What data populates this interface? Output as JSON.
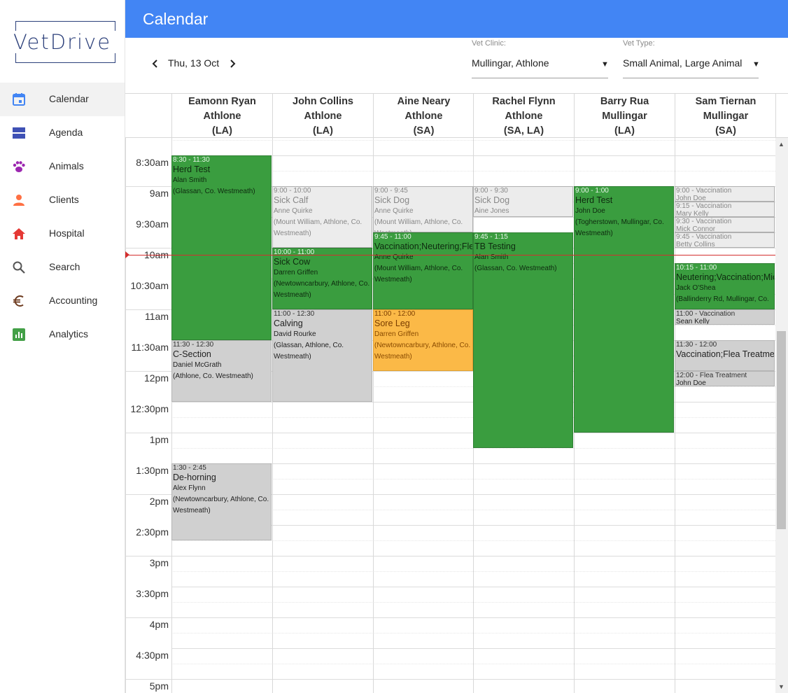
{
  "app": {
    "brand": "VetDrive"
  },
  "header": {
    "title": "Calendar"
  },
  "nav": [
    {
      "label": "Calendar",
      "icon": "calendar-icon",
      "active": true
    },
    {
      "label": "Agenda",
      "icon": "agenda-icon",
      "active": false
    },
    {
      "label": "Animals",
      "icon": "paw-icon",
      "active": false
    },
    {
      "label": "Clients",
      "icon": "person-icon",
      "active": false
    },
    {
      "label": "Hospital",
      "icon": "home-icon",
      "active": false
    },
    {
      "label": "Search",
      "icon": "search-icon",
      "active": false
    },
    {
      "label": "Accounting",
      "icon": "euro-icon",
      "active": false
    },
    {
      "label": "Analytics",
      "icon": "analytics-icon",
      "active": false
    }
  ],
  "toolbar": {
    "date": "Thu, 13 Oct",
    "clinic_label": "Vet Clinic:",
    "clinic_value": "Mullingar, Athlone",
    "type_label": "Vet Type:",
    "type_value": "Small Animal, Large Animal"
  },
  "colors": {
    "header": "#4285f4",
    "green": "#3a9d3f",
    "gray": "#d0d0d0",
    "orange": "#fbb947",
    "now": "#d32f2f"
  },
  "vets": [
    {
      "name": "Eamonn Ryan",
      "clinic": "Athlone",
      "type": "(LA)"
    },
    {
      "name": "John Collins",
      "clinic": "Athlone",
      "type": "(LA)"
    },
    {
      "name": "Aine Neary",
      "clinic": "Athlone",
      "type": "(SA)"
    },
    {
      "name": "Rachel Flynn",
      "clinic": "Athlone",
      "type": "(SA, LA)"
    },
    {
      "name": "Barry Rua",
      "clinic": "Mullingar",
      "type": "(LA)"
    },
    {
      "name": "Sam Tiernan",
      "clinic": "Mullingar",
      "type": "(SA)"
    }
  ],
  "time_labels": [
    "8:30am",
    "9am",
    "9:30am",
    "10am",
    "10:30am",
    "11am",
    "11:30am",
    "12pm",
    "12:30pm",
    "1pm",
    "1:30pm",
    "2pm",
    "2:30pm",
    "3pm",
    "3:30pm",
    "4pm",
    "4:30pm",
    "5pm"
  ],
  "events": [
    {
      "vet": 0,
      "start": 8.5,
      "end": 11.5,
      "time": "8:30 - 11:30",
      "title": "Herd Test",
      "client": "Alan Smith",
      "address": "(Glassan, Co. Westmeath)",
      "color": "green"
    },
    {
      "vet": 0,
      "start": 11.5,
      "end": 12.5,
      "time": "11:30 - 12:30",
      "title": "C-Section",
      "client": "Daniel McGrath",
      "address": "(Athlone, Co. Westmeath)",
      "color": "gray"
    },
    {
      "vet": 0,
      "start": 13.5,
      "end": 14.75,
      "time": "1:30 - 2:45",
      "title": "De-horning",
      "client": "Alex Flynn",
      "address": "(Newtowncarbury, Athlone, Co. Westmeath)",
      "color": "gray"
    },
    {
      "vet": 1,
      "start": 9.0,
      "end": 10.0,
      "time": "9:00 - 10:00",
      "title": "Sick Calf",
      "client": "Anne Quirke",
      "address": "(Mount William, Athlone, Co. Westmeath)",
      "color": "light"
    },
    {
      "vet": 1,
      "start": 10.0,
      "end": 11.0,
      "time": "10:00 - 11:00",
      "title": "Sick Cow",
      "client": "Darren Griffen",
      "address": "(Newtowncarbury, Athlone, Co. Westmeath)",
      "color": "green"
    },
    {
      "vet": 1,
      "start": 11.0,
      "end": 12.5,
      "time": "11:00 - 12:30",
      "title": "Calving",
      "client": "David Rourke",
      "address": "(Glassan, Athlone, Co. Westmeath)",
      "color": "gray"
    },
    {
      "vet": 2,
      "start": 9.0,
      "end": 9.75,
      "time": "9:00 - 9:45",
      "title": "Sick Dog",
      "client": "Anne Quirke",
      "address": "(Mount William, Athlone, Co. Westmeath)",
      "color": "light"
    },
    {
      "vet": 2,
      "start": 9.75,
      "end": 11.0,
      "time": "9:45 - 11:00",
      "title": "Vaccination;Neutering;Flea Treatment",
      "client": "Anne Quirke",
      "address": "(Mount William, Athlone, Co. Westmeath)",
      "color": "green"
    },
    {
      "vet": 2,
      "start": 11.0,
      "end": 12.0,
      "time": "11:00 - 12:00",
      "title": "Sore Leg",
      "client": "Darren Griffen",
      "address": "(Newtowncarbury, Athlone, Co. Westmeath)",
      "color": "orange"
    },
    {
      "vet": 3,
      "start": 9.0,
      "end": 9.5,
      "time": "9:00 - 9:30",
      "title": "Sick Dog",
      "client": "Aine Jones",
      "address": "",
      "color": "light"
    },
    {
      "vet": 3,
      "start": 9.75,
      "end": 13.25,
      "time": "9:45 - 1:15",
      "title": "TB Testing",
      "client": "Alan Smith",
      "address": "(Glassan, Co. Westmeath)",
      "color": "green"
    },
    {
      "vet": 4,
      "start": 9.0,
      "end": 13.0,
      "time": "9:00 - 1:00",
      "title": "Herd Test",
      "client": "John Doe",
      "address": "(Togherstown, Mullingar, Co. Westmeath)",
      "color": "green"
    },
    {
      "vet": 5,
      "start": 9.0,
      "end": 9.25,
      "time": "9:00 - Vaccination",
      "title": "John Doe",
      "client": "",
      "address": "",
      "color": "light",
      "small": true
    },
    {
      "vet": 5,
      "start": 9.25,
      "end": 9.5,
      "time": "9:15 - Vaccination",
      "title": "Mary Kelly",
      "client": "",
      "address": "",
      "color": "light",
      "small": true
    },
    {
      "vet": 5,
      "start": 9.5,
      "end": 9.75,
      "time": "9:30 - Vaccination",
      "title": "Mick Connor",
      "client": "",
      "address": "",
      "color": "light",
      "small": true
    },
    {
      "vet": 5,
      "start": 9.75,
      "end": 10.0,
      "time": "9:45 - Vaccination",
      "title": "Betty Collins",
      "client": "",
      "address": "",
      "color": "light",
      "small": true
    },
    {
      "vet": 5,
      "start": 10.25,
      "end": 11.0,
      "time": "10:15 - 11:00",
      "title": "Neutering;Vaccination;Micro",
      "client": "Jack O'Shea",
      "address": "(Ballinderry Rd, Mullingar, Co.",
      "color": "green"
    },
    {
      "vet": 5,
      "start": 11.0,
      "end": 11.25,
      "time": "11:00 - Vaccination",
      "title": "Sean Kelly",
      "client": "",
      "address": "",
      "color": "gray",
      "small": true
    },
    {
      "vet": 5,
      "start": 11.5,
      "end": 12.0,
      "time": "11:30 - 12:00",
      "title": "Vaccination;Flea Treatment",
      "client": "",
      "address": "",
      "color": "gray"
    },
    {
      "vet": 5,
      "start": 12.0,
      "end": 12.25,
      "time": "12:00 - Flea Treatment",
      "title": "John Doe",
      "client": "",
      "address": "",
      "color": "gray",
      "small": true
    }
  ],
  "now_time": 10.0
}
